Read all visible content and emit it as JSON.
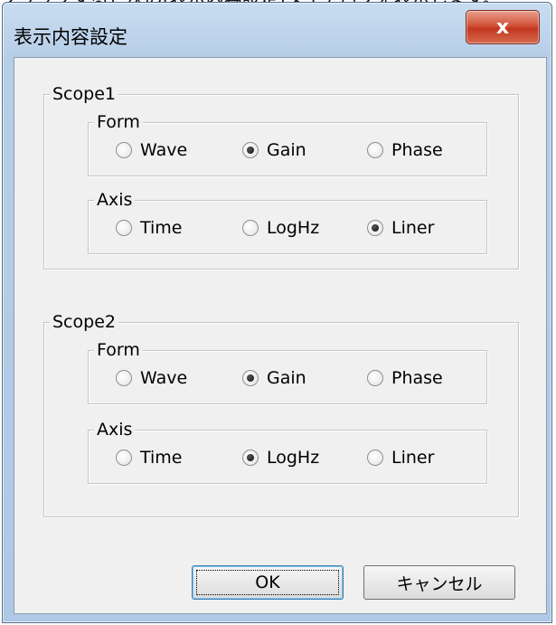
{
  "caption": "クリックすると次の[表示内容設定]ダイアログを表示します。",
  "window": {
    "title": "表示内容設定",
    "close_label": "x"
  },
  "scopes": [
    {
      "label": "Scope1",
      "form": {
        "label": "Form",
        "options": [
          "Wave",
          "Gain",
          "Phase"
        ],
        "selected": "Gain"
      },
      "axis": {
        "label": "Axis",
        "options": [
          "Time",
          "LogHz",
          "Liner"
        ],
        "selected": "Liner"
      }
    },
    {
      "label": "Scope2",
      "form": {
        "label": "Form",
        "options": [
          "Wave",
          "Gain",
          "Phase"
        ],
        "selected": "Gain"
      },
      "axis": {
        "label": "Axis",
        "options": [
          "Time",
          "LogHz",
          "Liner"
        ],
        "selected": "LogHz"
      }
    }
  ],
  "buttons": {
    "ok": "OK",
    "cancel": "キャンセル"
  }
}
